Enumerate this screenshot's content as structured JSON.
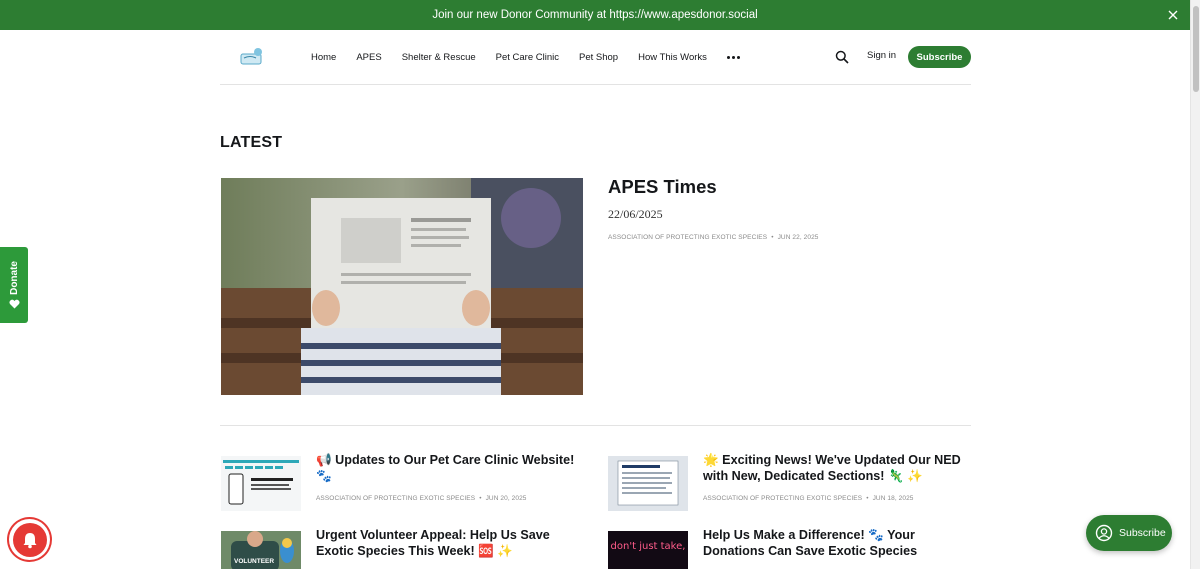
{
  "announcement": {
    "text": "Join our new Donor Community at https://www.apesdonor.social"
  },
  "nav": {
    "items": [
      "Home",
      "APES",
      "Shelter & Rescue",
      "Pet Care Clinic",
      "Pet Shop",
      "How This Works"
    ],
    "sign_in": "Sign in",
    "subscribe": "Subscribe"
  },
  "section_title": "LATEST",
  "featured": {
    "title": "APES Times",
    "subtitle": "22/06/2025",
    "author": "ASSOCIATION OF PROTECTING EXOTIC SPECIES",
    "date": "JUN 22, 2025"
  },
  "posts": [
    {
      "title": "📢 Updates to Our Pet Care Clinic Website! 🐾",
      "author": "ASSOCIATION OF PROTECTING EXOTIC SPECIES",
      "date": "JUN 20, 2025"
    },
    {
      "title": "🌟 Exciting News! We've Updated Our NED with New, Dedicated Sections! 🦎 ✨",
      "author": "ASSOCIATION OF PROTECTING EXOTIC SPECIES",
      "date": "JUN 18, 2025"
    },
    {
      "title": "Urgent Volunteer Appeal: Help Us Save Exotic Species This Week! 🆘 ✨",
      "author": "",
      "date": ""
    },
    {
      "title": "Help Us Make a Difference! 🐾 Your Donations Can Save Exotic Species",
      "author": "",
      "date": ""
    }
  ],
  "thumb_texts": {
    "volunteer": "VOLUNTEER",
    "neon": "don't just take,"
  },
  "donate_tab": "Donate",
  "portal_subscribe": "Subscribe",
  "colors": {
    "brand_green": "#2d7d32",
    "donate_green": "#2d9a3a",
    "notif_red": "#e53935"
  }
}
